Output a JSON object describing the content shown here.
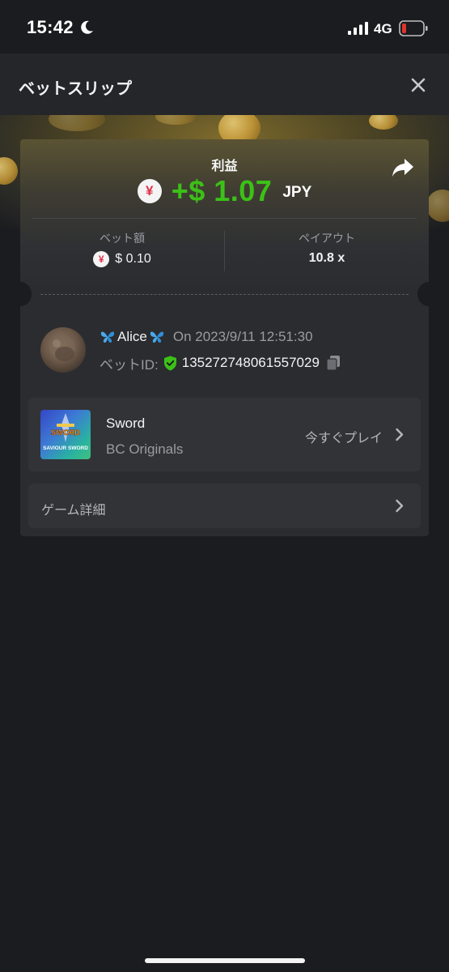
{
  "status_bar": {
    "time": "15:42",
    "network": "4G",
    "battery_color": "#e0342c"
  },
  "header": {
    "title": "ベットスリップ"
  },
  "bet": {
    "profit_label": "利益",
    "currency_symbol": "¥",
    "profit_amount": "+$ 1.07",
    "profit_currency": "JPY",
    "profit_color": "#3bc117",
    "bet_amount_label": "ベット額",
    "bet_amount_value": "$ 0.10",
    "payout_label": "ペイアウト",
    "payout_value": "10.8 x"
  },
  "player": {
    "name": "Alice",
    "timestamp": "On 2023/9/11 12:51:30",
    "bet_id_label": "ベットID:",
    "bet_id": "135272748061557029"
  },
  "game": {
    "name": "Sword",
    "provider": "BC Originals",
    "play_label": "今すぐプレイ",
    "thumb_text_1": "SWORD",
    "thumb_text_2": "SAVIOUR SWORD"
  },
  "details": {
    "label": "ゲーム詳細"
  },
  "icons": [
    "moon-icon",
    "signal-icon",
    "battery-icon",
    "close-icon",
    "share-icon",
    "yen-icon",
    "butterfly-icon",
    "shield-check-icon",
    "copy-icon",
    "chevron-right-icon"
  ]
}
